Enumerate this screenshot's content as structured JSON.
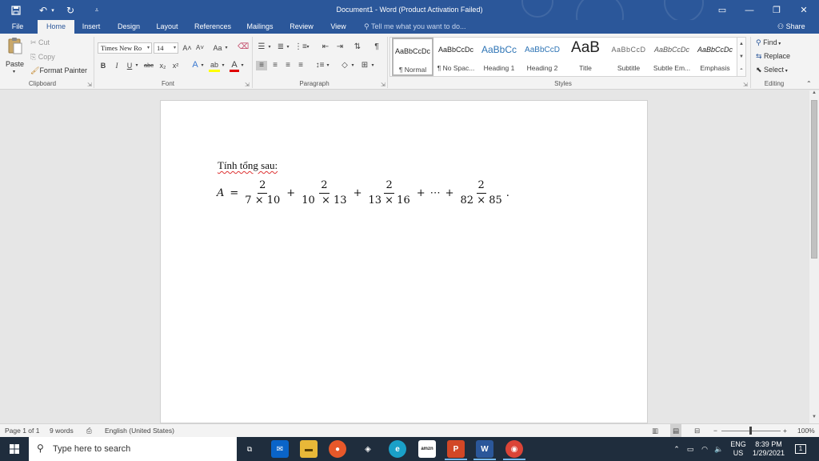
{
  "title_bar": {
    "document_title": "Document1 - Word (Product Activation Failed)",
    "save_icon": "save-icon",
    "undo_icon": "undo-icon",
    "redo_icon": "redo-icon",
    "customize_icon": "customize-quick-access-icon",
    "window_controls": {
      "ribbon_display": "▭",
      "minimize": "—",
      "restore": "❐",
      "close": "✕"
    }
  },
  "tabs": [
    "File",
    "Home",
    "Insert",
    "Design",
    "Layout",
    "References",
    "Mailings",
    "Review",
    "View"
  ],
  "active_tab": "Home",
  "tell_me": "Tell me what you want to do...",
  "share": "Share",
  "clipboard": {
    "paste": "Paste",
    "cut": "Cut",
    "copy": "Copy",
    "format_painter": "Format Painter",
    "label": "Clipboard"
  },
  "font": {
    "font_name": "Times New Ro",
    "font_size": "14",
    "grow": "A˄",
    "shrink": "A˅",
    "change_case": "Aa",
    "bold": "B",
    "italic": "I",
    "underline": "U",
    "strikethrough": "abc",
    "subscript": "x₂",
    "superscript": "x²",
    "text_effects": "A",
    "highlight": "ab",
    "font_color": "A",
    "label": "Font"
  },
  "paragraph": {
    "label": "Paragraph"
  },
  "styles": {
    "label": "Styles",
    "items": [
      {
        "preview": "AaBbCcDc",
        "name": "¶ Normal"
      },
      {
        "preview": "AaBbCcDc",
        "name": "¶ No Spac..."
      },
      {
        "preview": "AaBbCc",
        "name": "Heading 1"
      },
      {
        "preview": "AaBbCcD",
        "name": "Heading 2"
      },
      {
        "preview": "AaB",
        "name": "Title"
      },
      {
        "preview": "AaBbCcD",
        "name": "Subtitle"
      },
      {
        "preview": "AaBbCcDc",
        "name": "Subtle Em..."
      },
      {
        "preview": "AaBbCcDc",
        "name": "Emphasis"
      }
    ]
  },
  "editing": {
    "find": "Find",
    "replace": "Replace",
    "select": "Select",
    "label": "Editing"
  },
  "document": {
    "heading": "Tính tổng sau:",
    "equation": {
      "lhs": "A",
      "equals": "=",
      "terms": [
        {
          "num": "2",
          "den": "7 × 10"
        },
        {
          "num": "2",
          "den": "10  × 13"
        },
        {
          "num": "2",
          "den": "13 × 16"
        },
        {
          "num": "2",
          "den": "82 × 85"
        }
      ],
      "plus": "+",
      "ellipsis": "⋯",
      "period": "."
    }
  },
  "status_bar": {
    "page": "Page 1 of 1",
    "words": "9 words",
    "language": "English (United States)",
    "zoom": "100%"
  },
  "taskbar": {
    "search_placeholder": "Type here to search",
    "language": "ENG",
    "region": "US",
    "time": "8:39 PM",
    "date": "1/29/2021",
    "notifications": "1"
  }
}
